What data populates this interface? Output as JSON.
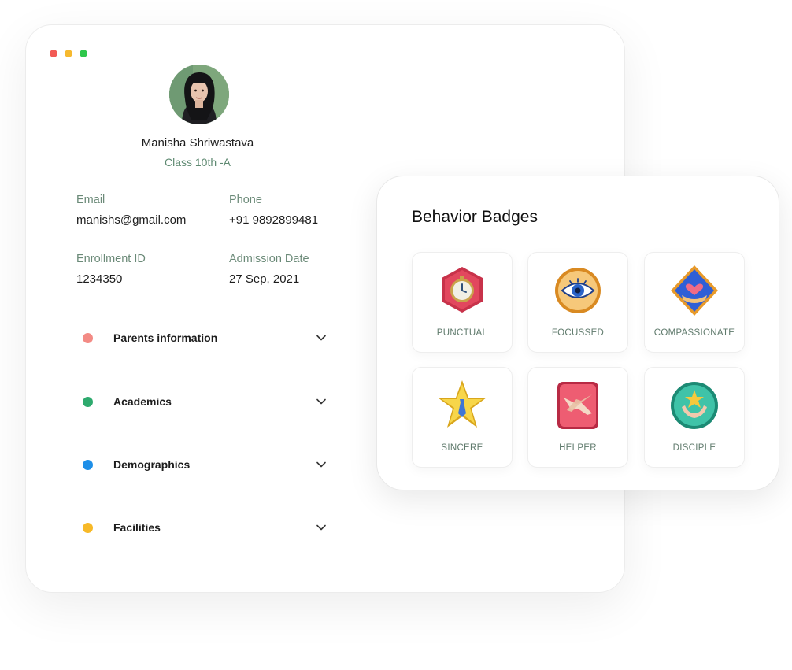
{
  "window": {
    "dot_colors": [
      "#f25a55",
      "#f6b92f",
      "#2ec74b"
    ]
  },
  "profile": {
    "name": "Manisha Shriwastava",
    "class": "Class 10th -A",
    "email_label": "Email",
    "email": "manishs@gmail.com",
    "phone_label": "Phone",
    "phone": "+91 9892899481",
    "enrollment_label": "Enrollment ID",
    "enrollment": "1234350",
    "admission_label": "Admission Date",
    "admission": "27 Sep, 2021"
  },
  "accordion": [
    {
      "label": "Parents information",
      "color": "#f38b85",
      "icon": "chevron-down-icon"
    },
    {
      "label": "Academics",
      "color": "#2eaa6e",
      "icon": "chevron-down-icon"
    },
    {
      "label": "Demographics",
      "color": "#1e8fe8",
      "icon": "chevron-down-icon"
    },
    {
      "label": "Facilities",
      "color": "#f7b928",
      "icon": "chevron-down-icon"
    }
  ],
  "badges": {
    "title": "Behavior Badges",
    "items": [
      {
        "label": "PUNCTUAL",
        "icon": "stopwatch-badge-icon"
      },
      {
        "label": "FOCUSSED",
        "icon": "eye-badge-icon"
      },
      {
        "label": "COMPASSIONATE",
        "icon": "heart-hand-badge-icon"
      },
      {
        "label": "SINCERE",
        "icon": "star-tie-badge-icon"
      },
      {
        "label": "HELPER",
        "icon": "helping-hands-badge-icon"
      },
      {
        "label": "DISCIPLE",
        "icon": "star-hands-badge-icon"
      }
    ]
  }
}
